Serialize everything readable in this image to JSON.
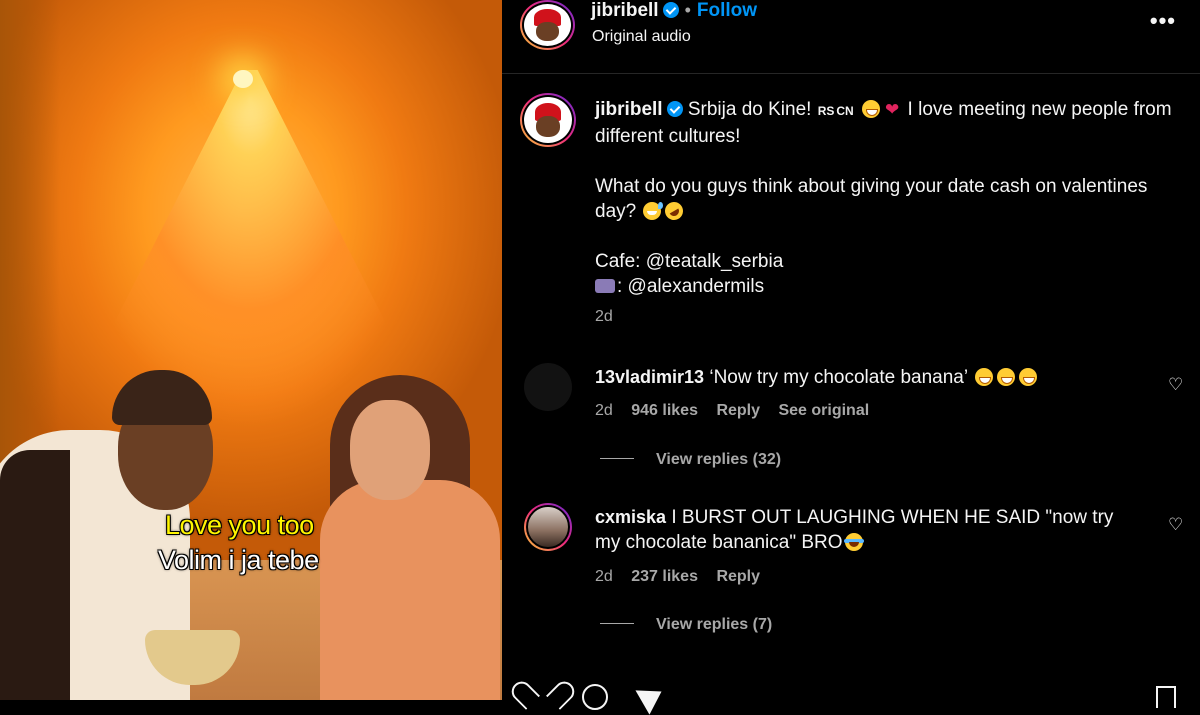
{
  "header": {
    "username": "jibribell",
    "separator": "•",
    "follow_label": "Follow",
    "audio": "Original audio",
    "more_label": "•••"
  },
  "video": {
    "caption_en": "Love you too",
    "caption_sr": "Volim i ja tebe"
  },
  "post_caption": {
    "username": "jibribell",
    "line1_text": "Srbija do Kine!",
    "flag_rs": "RS",
    "flag_cn": "CN",
    "line1_rest": "I love meeting new people from different cultures!",
    "para2": "What do you guys think about giving your date cash on valentines day?",
    "cafe_line": "Cafe: @teatalk_serbia",
    "camera_line": ": @alexandermils",
    "time": "2d"
  },
  "comments": [
    {
      "username": "13vladimir13",
      "text": "‘Now try my chocolate banana’",
      "time": "2d",
      "likes": "946 likes",
      "reply_label": "Reply",
      "see_original_label": "See original",
      "view_replies": "View replies (32)"
    },
    {
      "username": "cxmiska",
      "text": "I BURST OUT LAUGHING WHEN HE SAID \"now try my chocolate bananica\" BRO",
      "time": "2d",
      "likes": "237 likes",
      "reply_label": "Reply",
      "view_replies": "View replies (7)"
    }
  ],
  "colors": {
    "accent": "#0095f6",
    "background": "#000000",
    "muted_text": "#a8a8a8",
    "caption_yellow": "#fff600"
  },
  "icons": [
    "heart-icon",
    "comment-icon",
    "share-icon",
    "save-icon",
    "more-icon",
    "verified-icon"
  ]
}
